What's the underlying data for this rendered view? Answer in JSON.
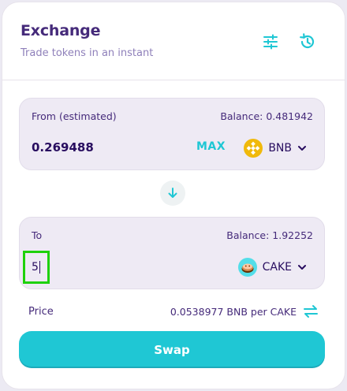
{
  "header": {
    "title": "Exchange",
    "subtitle": "Trade tokens in an instant",
    "settings_icon": "sliders-icon",
    "history_icon": "history-icon"
  },
  "from": {
    "label": "From (estimated)",
    "balance": "Balance: 0.481942",
    "amount": "0.269488",
    "max_label": "MAX",
    "token": "BNB",
    "token_icon": "bnb-logo-icon"
  },
  "switch_icon": "arrow-down-icon",
  "to": {
    "label": "To",
    "balance": "Balance: 1.92252",
    "amount": "5",
    "token": "CAKE",
    "token_icon": "cake-logo-icon"
  },
  "price": {
    "label": "Price",
    "value": "0.0538977 BNB per CAKE",
    "switch_icon": "swap-horizontal-icon"
  },
  "swap_button": "Swap",
  "colors": {
    "primary": "#1fc7d4",
    "text": "#452a7a",
    "subtle": "#8f80ba",
    "panel": "#eeeaf4",
    "highlight": "#1ed10a",
    "bnb": "#f0b90b"
  }
}
